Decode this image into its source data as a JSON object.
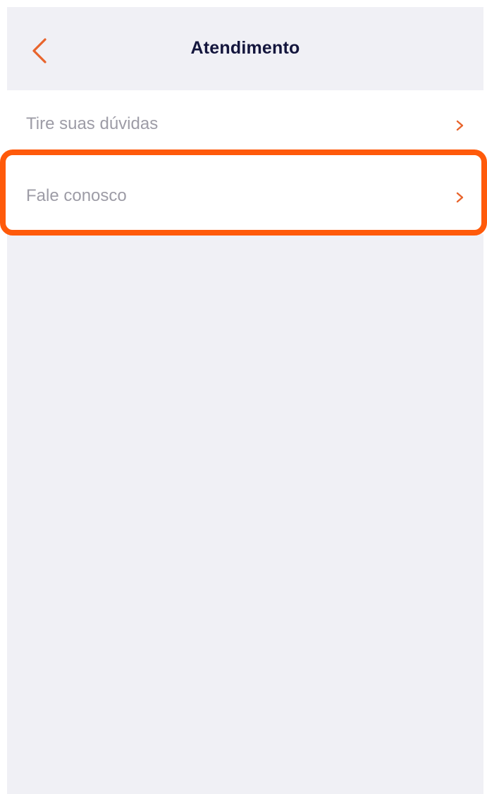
{
  "header": {
    "title": "Atendimento",
    "back_icon": "chevron-left-icon"
  },
  "menu": {
    "items": [
      {
        "label": "Tire suas dúvidas",
        "icon": "chevron-right-icon"
      },
      {
        "label": "Fale conosco",
        "icon": "chevron-right-icon",
        "highlighted": true
      }
    ]
  },
  "colors": {
    "accent": "#e8642c",
    "title": "#14163d",
    "label": "#9d9ca6",
    "background": "#f0f0f5",
    "highlight": "#ff5a0a"
  }
}
